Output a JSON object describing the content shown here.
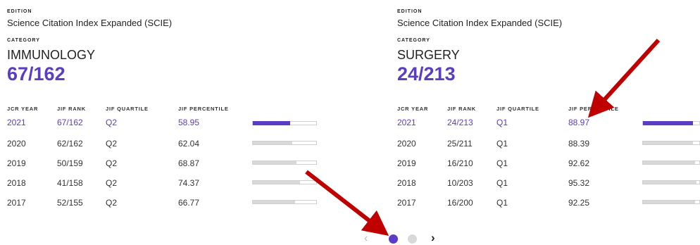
{
  "cards": [
    {
      "edition_label": "EDITION",
      "edition": "Science Citation Index Expanded (SCIE)",
      "category_label": "CATEGORY",
      "category": "IMMUNOLOGY",
      "rank": "67/162",
      "headers": [
        "JCR YEAR",
        "JIF RANK",
        "JIF QUARTILE",
        "JIF PERCENTILE"
      ],
      "rows": [
        {
          "year": "2021",
          "rank": "67/162",
          "quartile": "Q2",
          "percentile": "58.95",
          "pct": 0.5895
        },
        {
          "year": "2020",
          "rank": "62/162",
          "quartile": "Q2",
          "percentile": "62.04",
          "pct": 0.6204
        },
        {
          "year": "2019",
          "rank": "50/159",
          "quartile": "Q2",
          "percentile": "68.87",
          "pct": 0.6887
        },
        {
          "year": "2018",
          "rank": "41/158",
          "quartile": "Q2",
          "percentile": "74.37",
          "pct": 0.7437
        },
        {
          "year": "2017",
          "rank": "52/155",
          "quartile": "Q2",
          "percentile": "66.77",
          "pct": 0.6677
        }
      ]
    },
    {
      "edition_label": "EDITION",
      "edition": "Science Citation Index Expanded (SCIE)",
      "category_label": "CATEGORY",
      "category": "SURGERY",
      "rank": "24/213",
      "headers": [
        "JCR YEAR",
        "JIF RANK",
        "JIF QUARTILE",
        "JIF PERCENTILE"
      ],
      "rows": [
        {
          "year": "2021",
          "rank": "24/213",
          "quartile": "Q1",
          "percentile": "88.97",
          "pct": 0.8897
        },
        {
          "year": "2020",
          "rank": "25/211",
          "quartile": "Q1",
          "percentile": "88.39",
          "pct": 0.8839
        },
        {
          "year": "2019",
          "rank": "16/210",
          "quartile": "Q1",
          "percentile": "92.62",
          "pct": 0.9262
        },
        {
          "year": "2018",
          "rank": "10/203",
          "quartile": "Q1",
          "percentile": "95.32",
          "pct": 0.9532
        },
        {
          "year": "2017",
          "rank": "16/200",
          "quartile": "Q1",
          "percentile": "92.25",
          "pct": 0.9225
        }
      ]
    }
  ],
  "pagination": {
    "prev_icon": "chevron-left-icon",
    "next_icon": "chevron-right-icon",
    "current_page": 1,
    "total_pages": 2
  },
  "colors": {
    "accent": "#5b3cc4",
    "bar_track": "#d9d9d9",
    "arrow": "#c00000"
  }
}
